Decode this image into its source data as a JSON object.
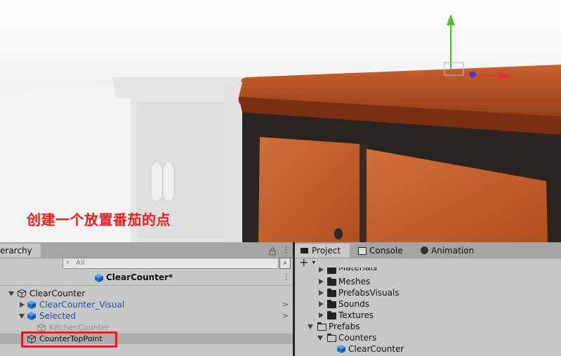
{
  "caption": "创建一个放置番茄的点",
  "hierarchy": {
    "tab_label": "erarchy",
    "search_placeholder": "All",
    "prefab_title": "ClearCounter*",
    "items": [
      {
        "label": "ClearCounter"
      },
      {
        "label": "ClearCounter_Visual"
      },
      {
        "label": "Selected"
      },
      {
        "label": "KitchenCounter"
      },
      {
        "label": "CounterTopPoint"
      }
    ]
  },
  "project": {
    "tabs": [
      {
        "label": "Project",
        "icon": "folder-icon"
      },
      {
        "label": "Console",
        "icon": "console-icon"
      },
      {
        "label": "Animation",
        "icon": "animation-icon"
      }
    ],
    "add_label": "+",
    "items": [
      {
        "label": "Materials"
      },
      {
        "label": "Meshes"
      },
      {
        "label": "PrefabsVisuals"
      },
      {
        "label": "Sounds"
      },
      {
        "label": "Textures"
      },
      {
        "label": "Prefabs"
      },
      {
        "label": "Counters"
      },
      {
        "label": "ClearCounter"
      }
    ]
  },
  "colors": {
    "highlight_box": "#e0201e",
    "prefab_blue": "#1f6fd6",
    "selected_row": "#adadad"
  }
}
